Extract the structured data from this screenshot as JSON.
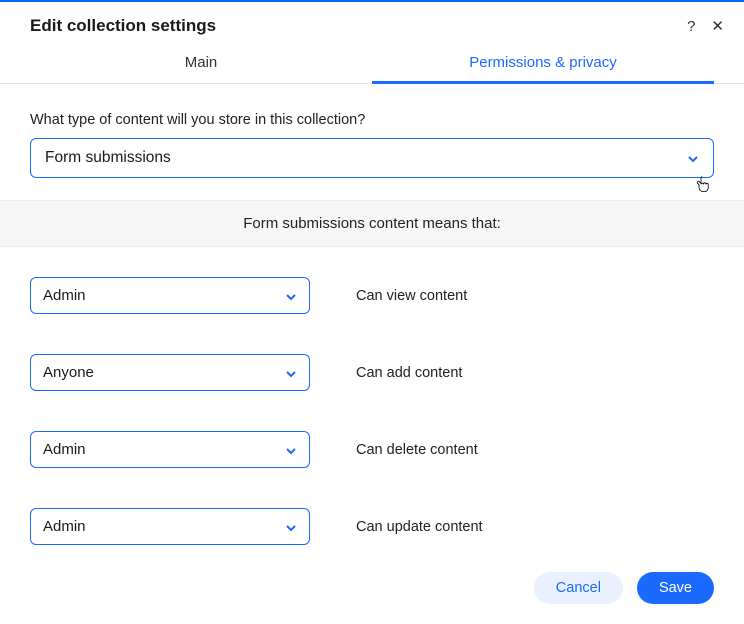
{
  "header": {
    "title": "Edit collection settings"
  },
  "tabs": {
    "main": "Main",
    "permissions": "Permissions & privacy"
  },
  "contentTypeLabel": "What type of content will you store in this collection?",
  "contentTypeValue": "Form submissions",
  "infoBand": "Form submissions content means that:",
  "permissions": [
    {
      "role": "Admin",
      "label": "Can view content"
    },
    {
      "role": "Anyone",
      "label": "Can add content"
    },
    {
      "role": "Admin",
      "label": "Can delete content"
    },
    {
      "role": "Admin",
      "label": "Can update content"
    }
  ],
  "buttons": {
    "cancel": "Cancel",
    "save": "Save"
  }
}
